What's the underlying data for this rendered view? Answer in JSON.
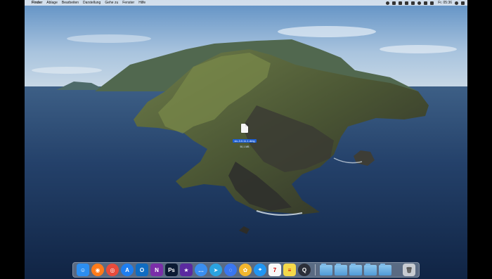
{
  "menubar": {
    "apple": "",
    "items": [
      "Finder",
      "Ablage",
      "Bearbeiten",
      "Darstellung",
      "Gehe zu",
      "Fenster",
      "Hilfe"
    ],
    "clock": "Fr. 05:36"
  },
  "desktop_file": {
    "name": "vlc-3.0.11.1.dmg",
    "size": "50,1 MB"
  },
  "dock": {
    "apps": [
      {
        "name": "finder",
        "glyph": "☺",
        "color": "#2c8ef0"
      },
      {
        "name": "firefox",
        "glyph": "◉",
        "color": "#ff7b1a"
      },
      {
        "name": "chrome",
        "glyph": "◎",
        "color": "#e84b3c"
      },
      {
        "name": "app-store",
        "glyph": "A",
        "color": "#1e7ef0"
      },
      {
        "name": "outlook",
        "glyph": "O",
        "color": "#0f6cc1"
      },
      {
        "name": "onenote",
        "glyph": "N",
        "color": "#7a2ea8"
      },
      {
        "name": "photoshop",
        "glyph": "Ps",
        "color": "#0b1a33"
      },
      {
        "name": "imovie",
        "glyph": "★",
        "color": "#5b2aa0"
      },
      {
        "name": "messages",
        "glyph": "…",
        "color": "#3a8ef0"
      },
      {
        "name": "telegram",
        "glyph": "➤",
        "color": "#2aa3e0"
      },
      {
        "name": "signal",
        "glyph": "◌",
        "color": "#3a76f0"
      },
      {
        "name": "photos",
        "glyph": "✿",
        "color": "#f2b62e"
      },
      {
        "name": "safari",
        "glyph": "⌖",
        "color": "#2196f3"
      },
      {
        "name": "calendar",
        "glyph": "7",
        "color": "#f8f8f8"
      },
      {
        "name": "notes",
        "glyph": "≡",
        "color": "#f5d94a"
      },
      {
        "name": "quicktime",
        "glyph": "Q",
        "color": "#2b2f3a"
      }
    ],
    "folders": [
      "folder-1",
      "folder-2",
      "folder-3",
      "folder-4",
      "folder-5"
    ]
  }
}
